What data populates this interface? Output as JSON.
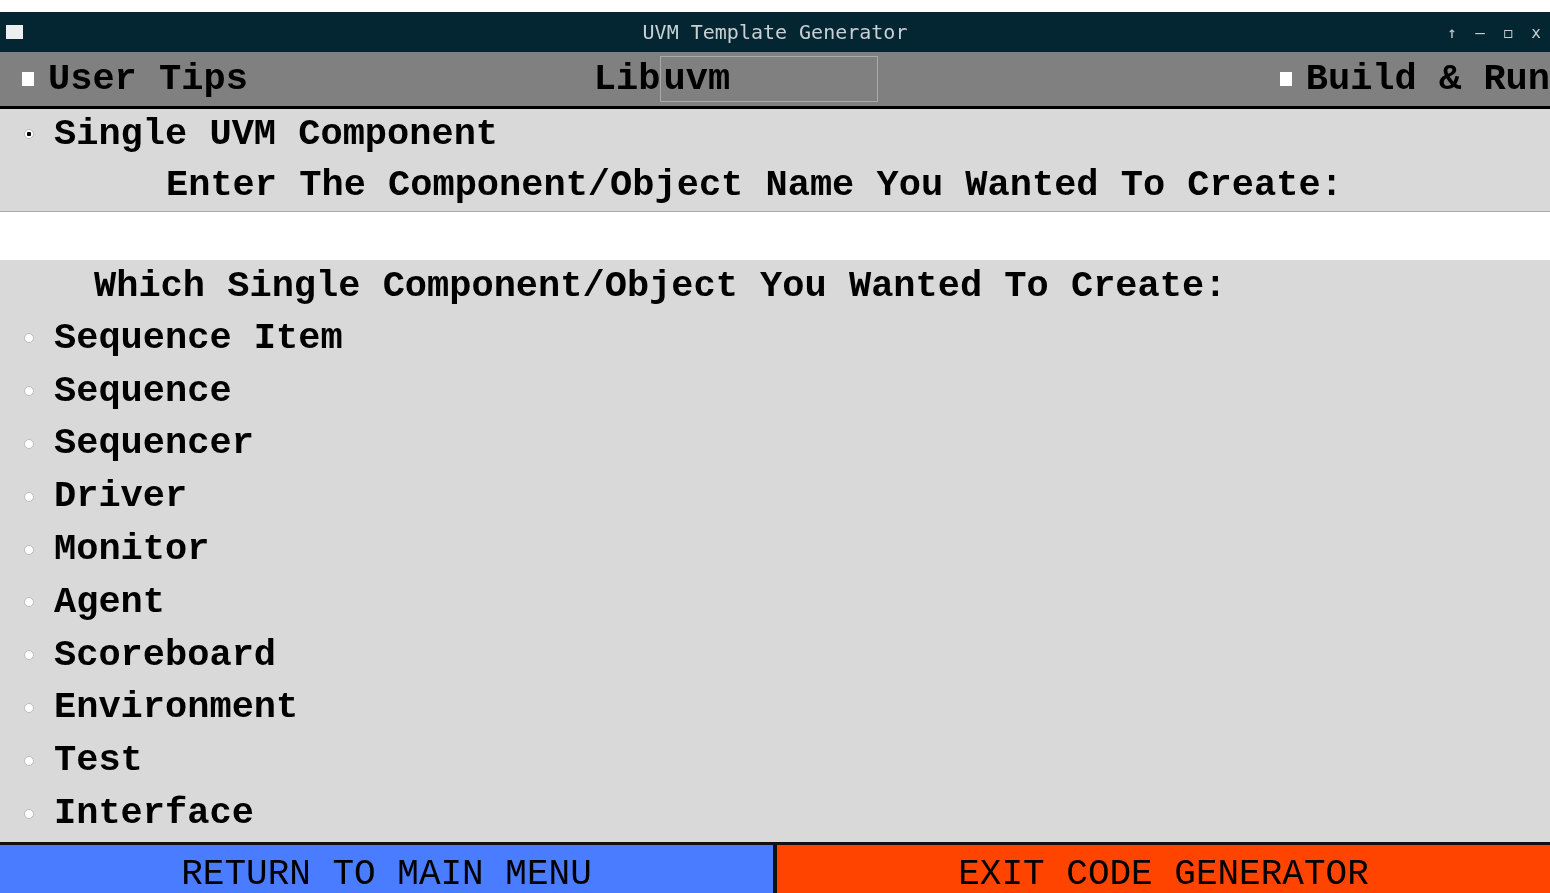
{
  "window": {
    "title": "UVM Template Generator",
    "controls": [
      "↑",
      "–",
      "◻",
      "x"
    ]
  },
  "toolbar": {
    "user_tips": {
      "label": "User Tips",
      "checked": false
    },
    "library": {
      "label": "Lib",
      "value": "uvm"
    },
    "build_run": {
      "label": "Build & Run",
      "checked": false
    }
  },
  "mode": {
    "label": "Single UVM Component",
    "selected": true
  },
  "name_prompt": "Enter The Component/Object Name You Wanted To Create:",
  "type_prompt": "Which Single Component/Object You Wanted To Create:",
  "components": [
    {
      "label": "Sequence Item",
      "selected": false
    },
    {
      "label": "Sequence",
      "selected": false
    },
    {
      "label": "Sequencer",
      "selected": false
    },
    {
      "label": "Driver",
      "selected": false
    },
    {
      "label": "Monitor",
      "selected": false
    },
    {
      "label": "Agent",
      "selected": false
    },
    {
      "label": "Scoreboard",
      "selected": false
    },
    {
      "label": "Environment",
      "selected": false
    },
    {
      "label": "Test",
      "selected": false
    },
    {
      "label": "Interface",
      "selected": false
    }
  ],
  "buttons": [
    {
      "kind": "return",
      "label": "RETURN TO MAIN MENU"
    },
    {
      "kind": "exit",
      "label": "EXIT CODE GENERATOR"
    }
  ]
}
